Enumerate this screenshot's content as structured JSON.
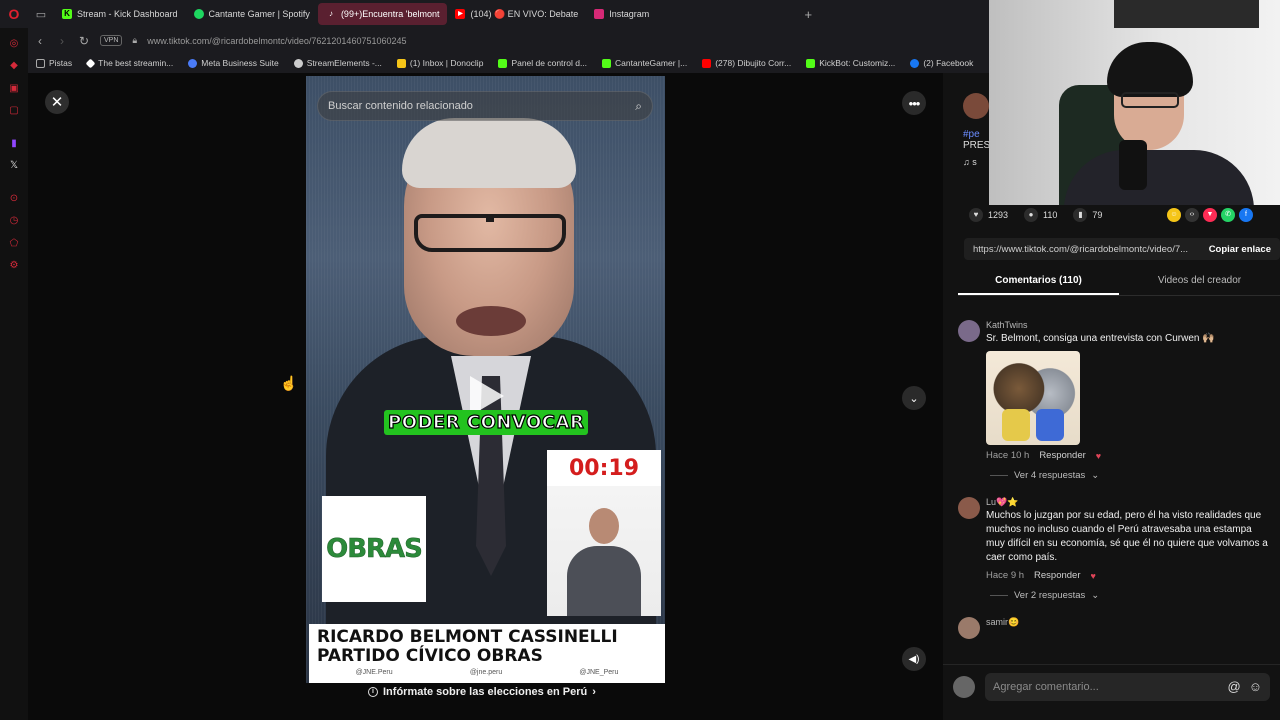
{
  "browser": {
    "tabs": [
      {
        "label": "Stream - Kick Dashboard",
        "color": "#53fc18"
      },
      {
        "label": "Cantante Gamer | Spotify",
        "color": "#1ed760"
      },
      {
        "label": "(99+)Encuentra 'belmont",
        "color": "#ffffff"
      },
      {
        "label": "(104) 🔴 EN VIVO: Debate",
        "color": "#ff0000"
      },
      {
        "label": "Instagram",
        "color": "#d62976"
      }
    ],
    "active_tab": 2,
    "url": "www.tiktok.com/@ricardobelmontc/video/7621201460751060245",
    "vpn_label": "VPN",
    "bookmarks": [
      {
        "label": "Pistas",
        "color": "#888888"
      },
      {
        "label": "The best streamin...",
        "color": "#ffffff"
      },
      {
        "label": "Meta Business Suite",
        "color": "#4a7bf7"
      },
      {
        "label": "StreamElements -...",
        "color": "#cccccc"
      },
      {
        "label": "(1) Inbox | Donoclip",
        "color": "#f5c518"
      },
      {
        "label": "Panel de control d...",
        "color": "#53fc18"
      },
      {
        "label": "CantanteGamer |...",
        "color": "#53fc18"
      },
      {
        "label": "(278) Dibujito Corr...",
        "color": "#ff0000"
      },
      {
        "label": "KickBot: Customiz...",
        "color": "#53fc18"
      },
      {
        "label": "(2) Facebook",
        "color": "#1877f2"
      }
    ]
  },
  "video": {
    "search_placeholder": "Buscar contenido relacionado",
    "caption": "PODER CONVOCAR",
    "timer": "00:19",
    "party_logo": "OBRAS",
    "lower_third_line1": "RICARDO BELMONT CASSINELLI",
    "lower_third_line2": "PARTIDO CÍVICO OBRAS",
    "lower_third_credits": [
      "@JNE.Peru",
      "@jne.peru",
      "@JNE_Peru"
    ],
    "info_link": "Infórmate sobre las elecciones en Perú"
  },
  "creator": {
    "tag": "#pe",
    "desc": "PRES",
    "music": "♫ s"
  },
  "stats": {
    "likes": "1293",
    "comments": "110",
    "saves": "79"
  },
  "share_link": {
    "url": "https://www.tiktok.com/@ricardobelmontc/video/7...",
    "copy_label": "Copiar enlace"
  },
  "comment_tabs": {
    "comments_label": "Comentarios (110)",
    "creator_videos_label": "Videos del creador"
  },
  "comments": [
    {
      "user": "KathTwins",
      "text": "Sr. Belmont, consiga una entrevista con Curwen 🙌🏼",
      "time": "Hace 10 h",
      "reply_label": "Responder",
      "more_replies": "Ver 4 respuestas",
      "has_sticker": true
    },
    {
      "user": "Lu💖⭐",
      "text": "Muchos lo juzgan por su edad, pero él ha visto realidades que muchos no incluso cuando el Perú atravesaba una estampa muy difícil en su economía, sé que él no quiere que volvamos a caer como país.",
      "time": "Hace 9 h",
      "reply_label": "Responder",
      "more_replies": "Ver 2 respuestas",
      "has_sticker": false
    },
    {
      "user": "samir😊",
      "text": "",
      "time": "",
      "reply_label": "",
      "more_replies": "",
      "has_sticker": false
    }
  ],
  "comment_input": {
    "placeholder": "Agregar comentario..."
  }
}
